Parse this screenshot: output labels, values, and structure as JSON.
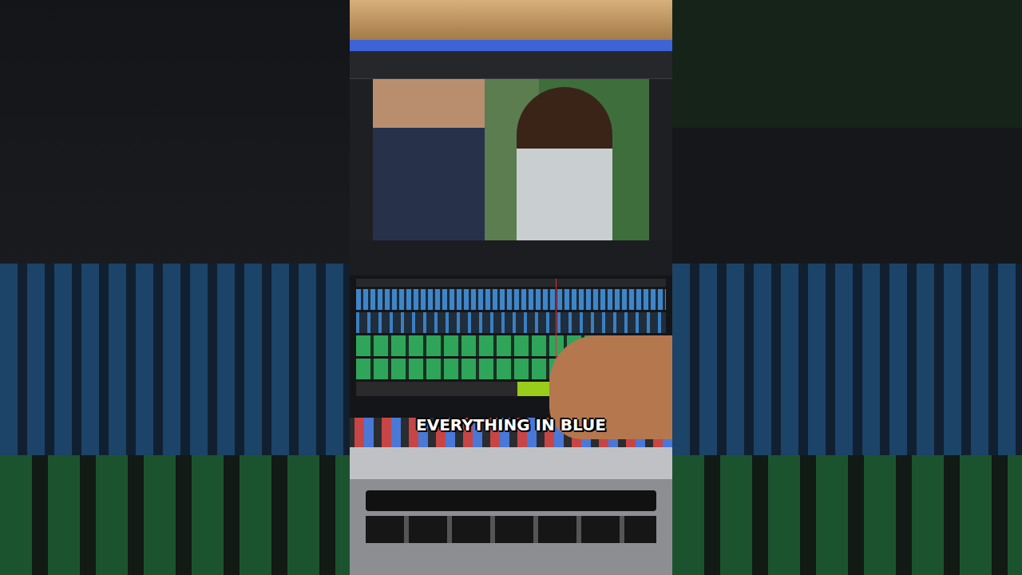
{
  "caption": {
    "text": "EVERYTHING IN BLUE"
  }
}
